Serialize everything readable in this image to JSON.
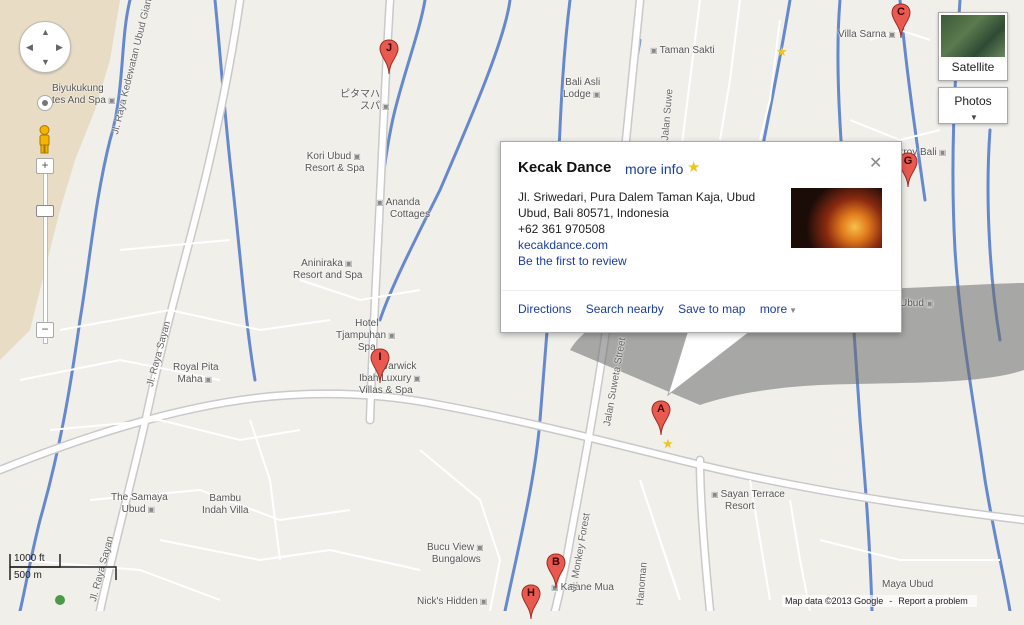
{
  "map": {
    "colors": {
      "background": "#f0efea",
      "road": "#ffffff",
      "road_outline": "#c9c9c9",
      "water": "#6688cc",
      "land": "#e8dcc4",
      "marker": "#e85a50",
      "link": "#1a3e9c"
    },
    "pois": [
      {
        "name_line1": "Biyukukung",
        "name_line2": "tes And Spa"
      },
      {
        "name_line1": "ピタマハ",
        "name_line2": "スパ"
      },
      {
        "name_line1": "Kori Ubud",
        "name_line2": "Resort & Spa"
      },
      {
        "name_line1": "Ananda",
        "name_line2": "Cottages"
      },
      {
        "name_line1": "Aniniraka",
        "name_line2": "Resort and Spa"
      },
      {
        "name_line1": "Hotel",
        "name_line2": "Tjampuhan"
      },
      {
        "name_line1": "Spa",
        "name_line2": ""
      },
      {
        "name_line1": "Warwick",
        "name_line2": "Ibah Luxury"
      },
      {
        "name_line1": "Villas & Spa",
        "name_line2": ""
      },
      {
        "name_line1": "Royal Pita",
        "name_line2": "Maha"
      },
      {
        "name_line1": "The Samaya",
        "name_line2": "Ubud"
      },
      {
        "name_line1": "Bambu",
        "name_line2": "Indah Villa"
      },
      {
        "name_line1": "Bucu View",
        "name_line2": "Bungalows"
      },
      {
        "name_line1": "Nick's Hidden",
        "name_line2": ""
      },
      {
        "name_line1": "Kajane Mua",
        "name_line2": ""
      },
      {
        "name_line1": "Taman Sakti",
        "name_line2": ""
      },
      {
        "name_line1": "Bali Asli",
        "name_line2": "Lodge"
      },
      {
        "name_line1": "Villa Sarna",
        "name_line2": ""
      },
      {
        "name_line1": "Sayan Terrace",
        "name_line2": "Resort"
      },
      {
        "name_line1": "Maya Ubud",
        "name_line2": ""
      },
      {
        "name_line1": "rroy Bali",
        "name_line2": ""
      },
      {
        "name_line1": "Ubud",
        "name_line2": ""
      }
    ],
    "streets": [
      "Jl. Raya Kedewatan Ubud Gianyar Bali",
      "Jl. Raya Sayan",
      "Jl. Raya Sayan",
      "Jalan Suweta Street",
      "Jl. Monkey Forest",
      "Hanoman",
      "Jalan Suwe"
    ],
    "markers": [
      "A",
      "B",
      "C",
      "G",
      "H",
      "I",
      "J"
    ]
  },
  "controls": {
    "pan_icon": "pan-arrows-icon",
    "pegman_icon": "pegman-icon",
    "zoom_in": "+",
    "zoom_out": "−",
    "zoom_out_bottom": "−",
    "zoom_out_top": "−"
  },
  "map_type": {
    "satellite_label": "Satellite",
    "photos_label": "Photos"
  },
  "info_window": {
    "title": "Kecak Dance",
    "more_info": "more info",
    "address_line1": "Jl. Sriwedari, Pura Dalem Taman Kaja, Ubud",
    "address_line2": "Ubud, Bali 80571, Indonesia",
    "phone": "+62 361 970508",
    "website": "kecakdance.com",
    "review": "Be the first to review",
    "actions": [
      "Directions",
      "Search nearby",
      "Save to map",
      "more"
    ]
  },
  "scale": {
    "imperial": "1000 ft",
    "metric": "500 m"
  },
  "footer": {
    "map_data": "Map data ©2013 Google",
    "separator": "-",
    "report": "Report a problem"
  }
}
